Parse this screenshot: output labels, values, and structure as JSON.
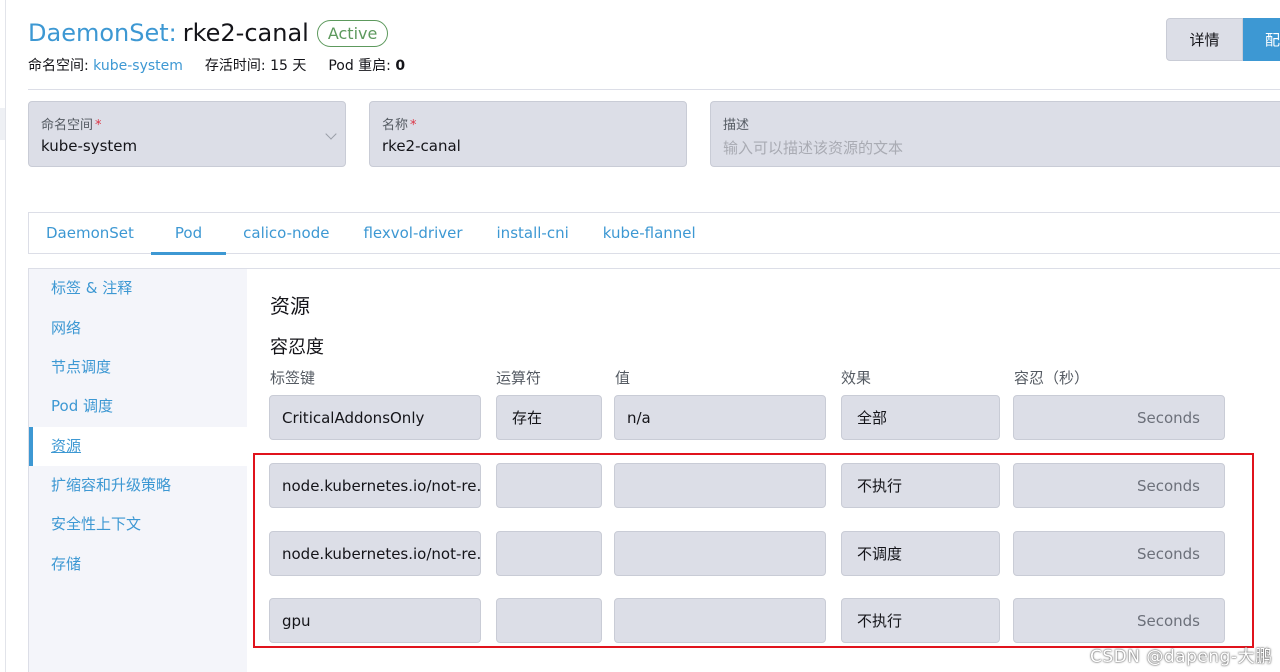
{
  "header": {
    "kind": "DaemonSet:",
    "name": "rke2-canal",
    "status": "Active",
    "meta": {
      "namespace_label": "命名空间:",
      "namespace_value": "kube-system",
      "age_label": "存活时间:",
      "age_value": "15 天",
      "restarts_label": "Pod 重启:",
      "restarts_value": "0"
    },
    "buttons": {
      "detail": "详情",
      "config": "配"
    }
  },
  "form": {
    "namespace": {
      "label": "命名空间",
      "required_mark": "*",
      "value": "kube-system"
    },
    "name": {
      "label": "名称",
      "required_mark": "*",
      "value": "rke2-canal"
    },
    "description": {
      "label": "描述",
      "placeholder": "输入可以描述该资源的文本"
    }
  },
  "tabs": [
    {
      "label": "DaemonSet"
    },
    {
      "label": "Pod"
    },
    {
      "label": "calico-node"
    },
    {
      "label": "flexvol-driver"
    },
    {
      "label": "install-cni"
    },
    {
      "label": "kube-flannel"
    }
  ],
  "active_tab": "Pod",
  "sidebar": {
    "items": [
      {
        "label": "标签 & 注释"
      },
      {
        "label": "网络"
      },
      {
        "label": "节点调度"
      },
      {
        "label": "Pod 调度"
      },
      {
        "label": "资源"
      },
      {
        "label": "扩缩容和升级策略"
      },
      {
        "label": "安全性上下文"
      },
      {
        "label": "存储"
      }
    ],
    "active": "资源"
  },
  "main": {
    "section_title": "资源",
    "subsection_title": "容忍度",
    "columns": [
      "标签键",
      "运算符",
      "值",
      "效果",
      "容忍（秒）"
    ],
    "rows": [
      {
        "key": "CriticalAddonsOnly",
        "operator": "存在",
        "value": "n/a",
        "effect": "全部",
        "seconds": "Seconds"
      },
      {
        "key": "node.kubernetes.io/not-re...",
        "operator": "",
        "value": "",
        "effect": "不执行",
        "seconds": "Seconds"
      },
      {
        "key": "node.kubernetes.io/not-re...",
        "operator": "",
        "value": "",
        "effect": "不调度",
        "seconds": "Seconds"
      },
      {
        "key": "gpu",
        "operator": "",
        "value": "",
        "effect": "不执行",
        "seconds": "Seconds"
      }
    ]
  },
  "watermark": "CSDN @dapeng-大鹏",
  "colors": {
    "accent": "#3d98d3",
    "status_green": "#5d995d",
    "field_bg": "#dcdee7",
    "highlight_red": "#e0131c"
  }
}
